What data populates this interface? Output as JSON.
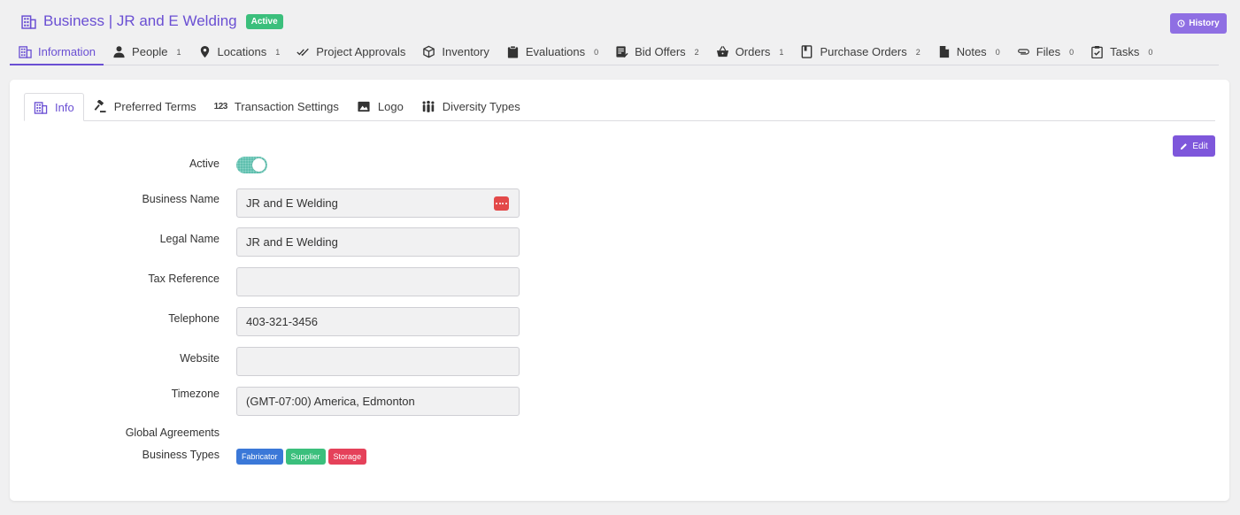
{
  "header": {
    "title": "Business | JR and E Welding",
    "status_badge": "Active",
    "history_label": "History",
    "accent_color": "#6a4fd3"
  },
  "main_tabs": [
    {
      "label": "Information",
      "icon": "building-icon",
      "count": "",
      "active": true
    },
    {
      "label": "People",
      "icon": "person-icon",
      "count": "1"
    },
    {
      "label": "Locations",
      "icon": "map-pin-icon",
      "count": "1"
    },
    {
      "label": "Project Approvals",
      "icon": "double-check-icon",
      "count": ""
    },
    {
      "label": "Inventory",
      "icon": "box-icon",
      "count": ""
    },
    {
      "label": "Evaluations",
      "icon": "clipboard-icon",
      "count": "0"
    },
    {
      "label": "Bid Offers",
      "icon": "document-check-icon",
      "count": "2"
    },
    {
      "label": "Orders",
      "icon": "basket-icon",
      "count": "1"
    },
    {
      "label": "Purchase Orders",
      "icon": "notebook-icon",
      "count": "2"
    },
    {
      "label": "Notes",
      "icon": "file-icon",
      "count": "0"
    },
    {
      "label": "Files",
      "icon": "paperclip-icon",
      "count": "0"
    },
    {
      "label": "Tasks",
      "icon": "clipboard-check-icon",
      "count": "0"
    }
  ],
  "sub_tabs": [
    {
      "label": "Info",
      "icon": "building-icon",
      "active": true
    },
    {
      "label": "Preferred Terms",
      "icon": "gavel-icon"
    },
    {
      "label": "Transaction Settings",
      "icon": "number-123-icon"
    },
    {
      "label": "Logo",
      "icon": "image-icon"
    },
    {
      "label": "Diversity Types",
      "icon": "people-group-icon"
    }
  ],
  "edit_label": "Edit",
  "form": {
    "active_label": "Active",
    "active_value": true,
    "business_name_label": "Business Name",
    "business_name_value": "JR and E Welding",
    "legal_name_label": "Legal Name",
    "legal_name_value": "JR and E Welding",
    "tax_reference_label": "Tax Reference",
    "tax_reference_value": "",
    "telephone_label": "Telephone",
    "telephone_value": "403-321-3456",
    "website_label": "Website",
    "website_value": "",
    "timezone_label": "Timezone",
    "timezone_value": "(GMT-07:00) America, Edmonton",
    "global_agreements_label": "Global Agreements",
    "business_types_label": "Business Types",
    "business_types": [
      {
        "label": "Fabricator",
        "color": "#3b78d8"
      },
      {
        "label": "Supplier",
        "color": "#3bbf7c"
      },
      {
        "label": "Storage",
        "color": "#e5415a"
      }
    ]
  }
}
